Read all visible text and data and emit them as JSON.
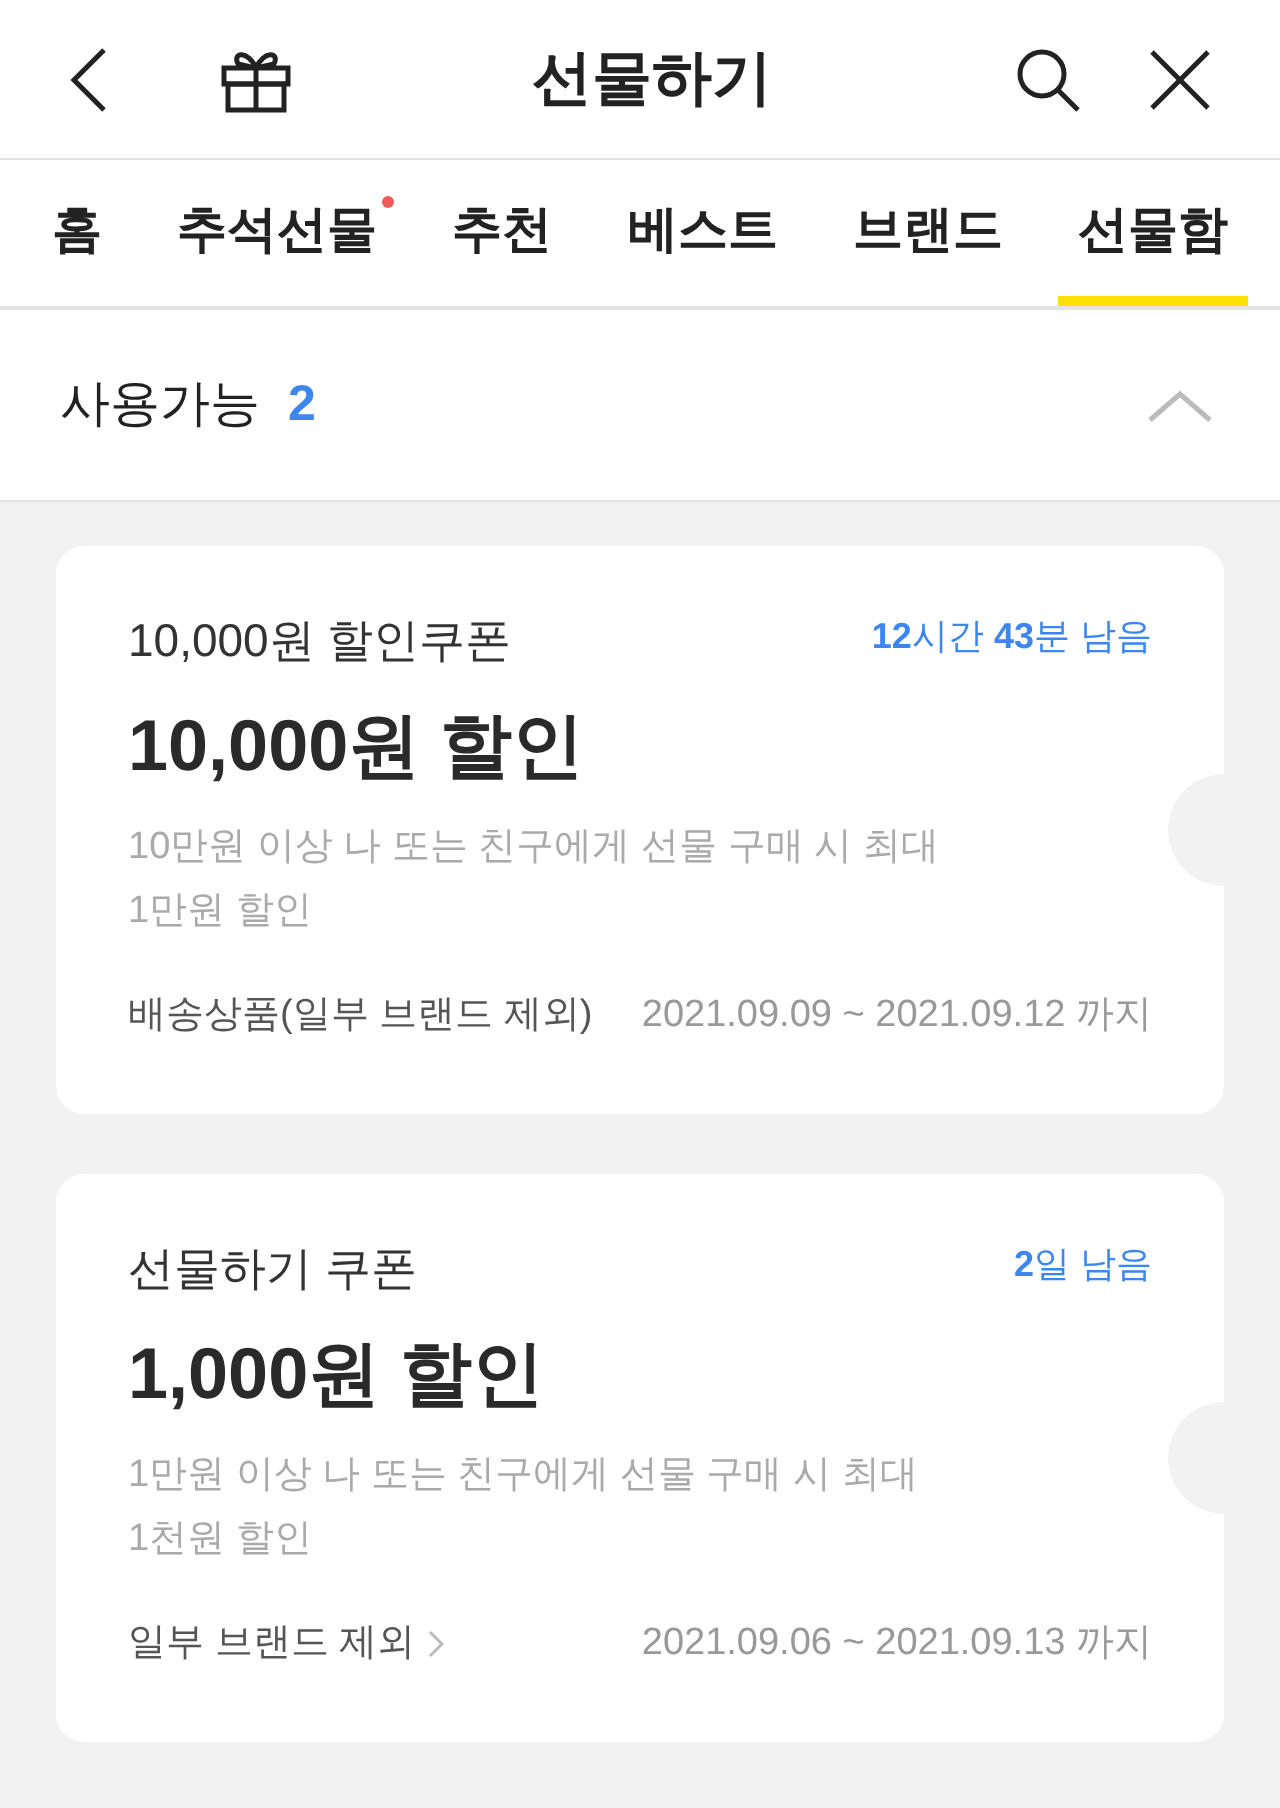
{
  "header": {
    "title": "선물하기"
  },
  "tabs": [
    {
      "label": "홈",
      "selected": false,
      "dot": false
    },
    {
      "label": "추석선물",
      "selected": false,
      "dot": true
    },
    {
      "label": "추천",
      "selected": false,
      "dot": false
    },
    {
      "label": "베스트",
      "selected": false,
      "dot": false
    },
    {
      "label": "브랜드",
      "selected": false,
      "dot": false
    },
    {
      "label": "선물함",
      "selected": true,
      "dot": false
    }
  ],
  "section": {
    "label": "사용가능",
    "count": "2",
    "expanded": true
  },
  "coupons": [
    {
      "name": "10,000원 할인쿠폰",
      "remaining": "**12**시간 **43**분 남음",
      "amount": "10,000원 할인",
      "description": "10만원 이상 나 또는 친구에게 선물 구매 시 최대 1만원 할인",
      "scope": "배송상품(일부 브랜드 제외)",
      "chevron": false,
      "period": "2021.09.09 ~ 2021.09.12 까지"
    },
    {
      "name": "선물하기 쿠폰",
      "remaining": "**2**일 남음",
      "amount": "1,000원 할인",
      "description": "1만원 이상 나 또는 친구에게 선물 구매 시 최대 1천원 할인",
      "scope": "일부 브랜드 제외",
      "chevron": true,
      "period": "2021.09.06 ~ 2021.09.13 까지"
    }
  ]
}
